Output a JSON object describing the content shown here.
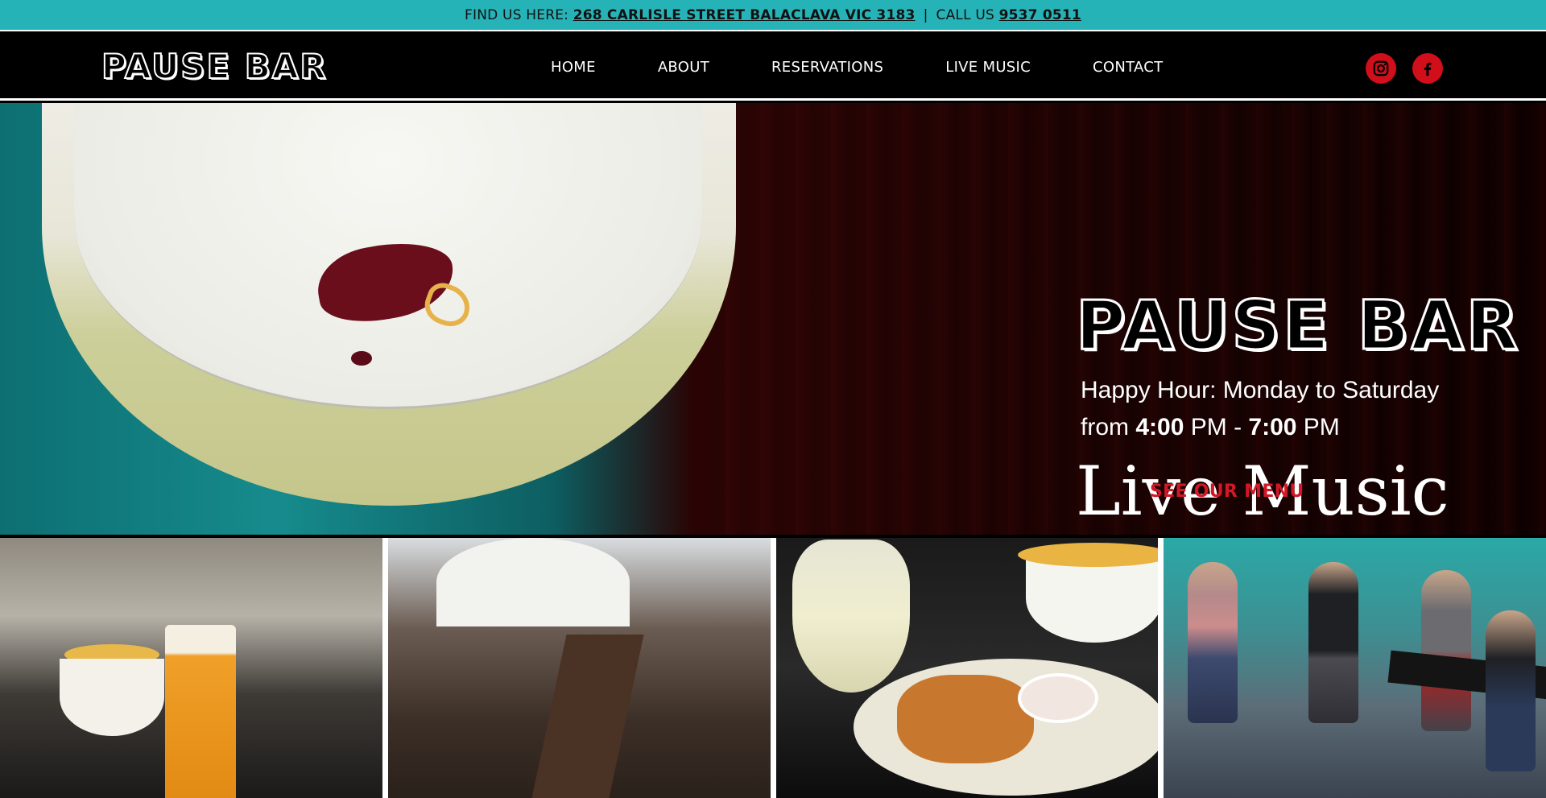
{
  "topbar": {
    "find_label": "FIND US HERE:",
    "address": "268 CARLISLE STREET BALACLAVA VIC 3183",
    "separator": "|",
    "call_label": "CALL US",
    "phone": "9537 0511"
  },
  "header": {
    "logo": "PAUSE BAR",
    "nav": [
      "HOME",
      "ABOUT",
      "RESERVATIONS",
      "LIVE MUSIC",
      "CONTACT"
    ],
    "social": [
      {
        "icon": "instagram-icon",
        "color": "#d10f1a"
      },
      {
        "icon": "facebook-icon",
        "color": "#d10f1a"
      }
    ]
  },
  "hero": {
    "title": "PAUSE BAR",
    "happy_line1": "Happy Hour: Monday to Saturday",
    "happy_from": "from",
    "happy_start": "4:00",
    "happy_pm1": "PM -",
    "happy_end": "7:00",
    "happy_pm2": "PM",
    "live_music": "Live Music",
    "menu_button": "SEE OUR MENU"
  },
  "colors": {
    "accent_teal": "#26b3b8",
    "brand_red": "#d11826",
    "header_bg": "#000000"
  },
  "gallery": {
    "tiles": [
      "beer-and-chips-photo",
      "bar-crowd-photo",
      "wine-and-food-photo",
      "live-band-photo"
    ]
  }
}
